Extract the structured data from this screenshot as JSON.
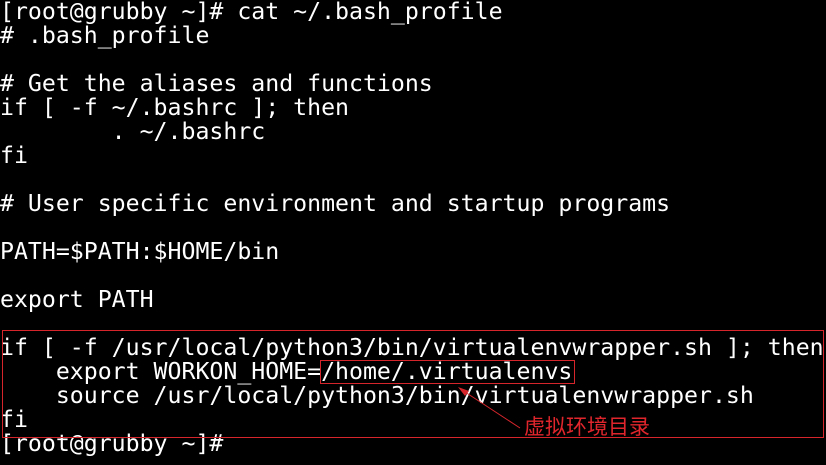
{
  "terminal": {
    "lines": [
      "[root@grubby ~]# cat ~/.bash_profile",
      "# .bash_profile",
      "",
      "# Get the aliases and functions",
      "if [ -f ~/.bashrc ]; then",
      "        . ~/.bashrc",
      "fi",
      "",
      "# User specific environment and startup programs",
      "",
      "PATH=$PATH:$HOME/bin",
      "",
      "export PATH",
      "",
      "if [ -f /usr/local/python3/bin/virtualenvwrapper.sh ]; then",
      "    export WORKON_HOME=/home/.virtualenvs",
      "    source /usr/local/python3/bin/virtualenvwrapper.sh",
      "fi",
      "[root@grubby ~]#"
    ]
  },
  "annotation": {
    "label": "虚拟环境目录",
    "color": "#d6262c"
  },
  "colors": {
    "background": "#000000",
    "text": "#ffffff",
    "annotation": "#d6262c"
  }
}
